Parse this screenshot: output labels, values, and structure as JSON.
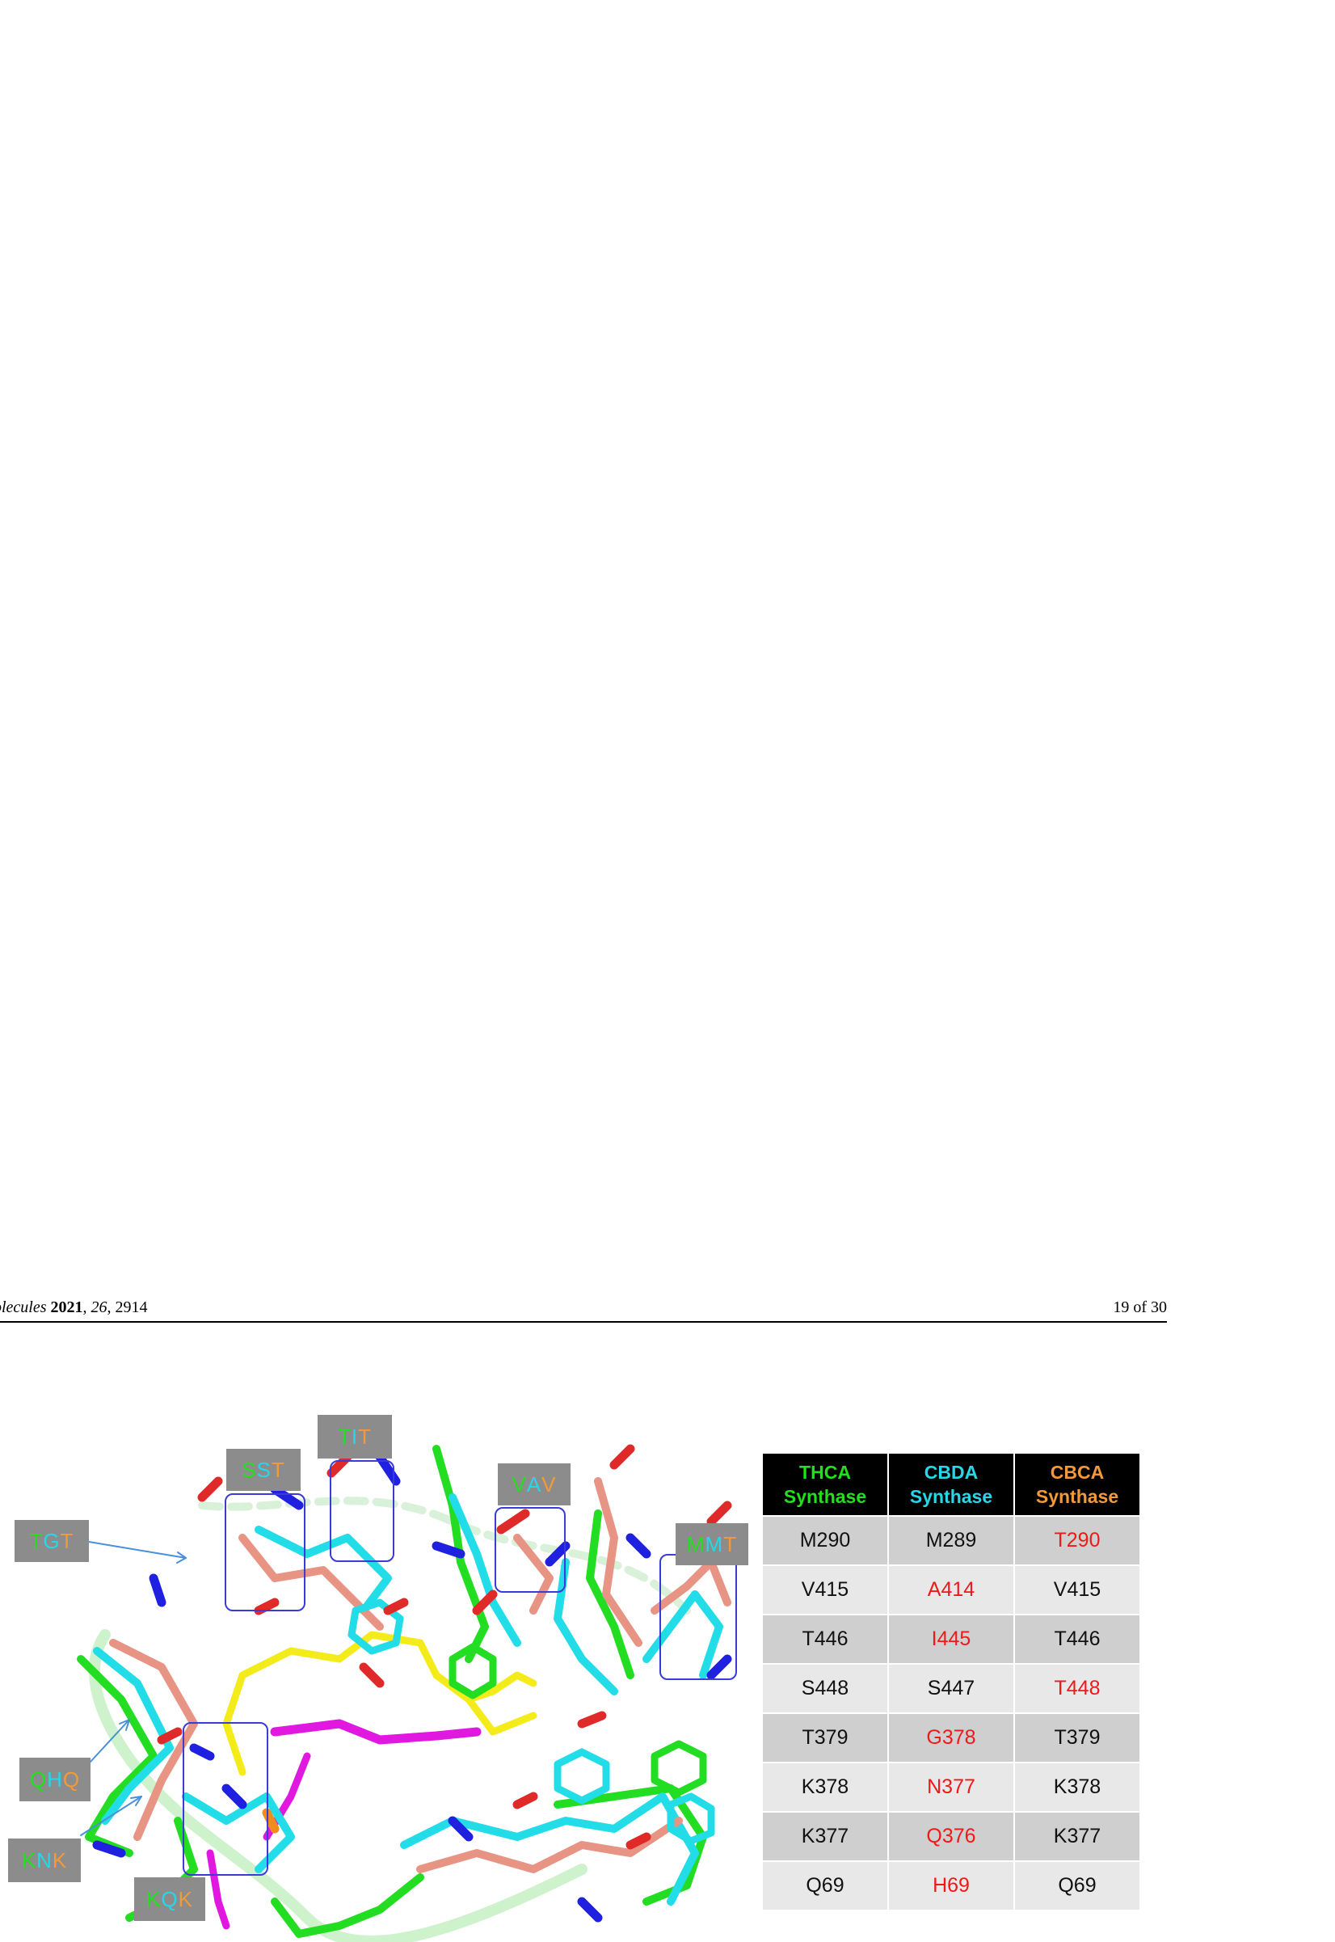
{
  "header": {
    "journal": "olecules",
    "year": "2021",
    "volume": "26",
    "article": "2914",
    "page": "19 of 30"
  },
  "colors": {
    "thca": "#22e01c",
    "cbda": "#26d7e8",
    "cbca": "#f29a3a",
    "mismatch": "#f01818"
  },
  "labels": [
    {
      "name": "tit",
      "parts": [
        "T",
        "I",
        "T"
      ]
    },
    {
      "name": "sst",
      "parts": [
        "S",
        "S",
        "T"
      ]
    },
    {
      "name": "vav",
      "parts": [
        "V",
        "A",
        "V"
      ]
    },
    {
      "name": "mmt",
      "parts": [
        "M",
        "M",
        "T"
      ]
    },
    {
      "name": "tgt",
      "parts": [
        "T",
        "G",
        "T"
      ]
    },
    {
      "name": "qhq",
      "parts": [
        "Q",
        "H",
        "Q"
      ]
    },
    {
      "name": "knk",
      "parts": [
        "K",
        "N",
        "K"
      ]
    },
    {
      "name": "kqk",
      "parts": [
        "K",
        "Q",
        "K"
      ]
    }
  ],
  "table": {
    "headers": [
      {
        "line1": "THCA",
        "line2": "Synthase"
      },
      {
        "line1": "CBDA",
        "line2": "Synthase"
      },
      {
        "line1": "CBCA",
        "line2": "Synthase"
      }
    ],
    "rows": [
      [
        {
          "text": "M290",
          "red": false
        },
        {
          "text": "M289",
          "red": false
        },
        {
          "text": "T290",
          "red": true
        }
      ],
      [
        {
          "text": "V415",
          "red": false
        },
        {
          "text": "A414",
          "red": true
        },
        {
          "text": "V415",
          "red": false
        }
      ],
      [
        {
          "text": "T446",
          "red": false
        },
        {
          "text": "I445",
          "red": true
        },
        {
          "text": "T446",
          "red": false
        }
      ],
      [
        {
          "text": "S448",
          "red": false
        },
        {
          "text": "S447",
          "red": false
        },
        {
          "text": "T448",
          "red": true
        }
      ],
      [
        {
          "text": "T379",
          "red": false
        },
        {
          "text": "G378",
          "red": true
        },
        {
          "text": "T379",
          "red": false
        }
      ],
      [
        {
          "text": "K378",
          "red": false
        },
        {
          "text": "N377",
          "red": true
        },
        {
          "text": "K378",
          "red": false
        }
      ],
      [
        {
          "text": "K377",
          "red": false
        },
        {
          "text": "Q376",
          "red": true
        },
        {
          "text": "K377",
          "red": false
        }
      ],
      [
        {
          "text": "Q69",
          "red": false
        },
        {
          "text": "H69",
          "red": true
        },
        {
          "text": "Q69",
          "red": false
        }
      ]
    ]
  }
}
